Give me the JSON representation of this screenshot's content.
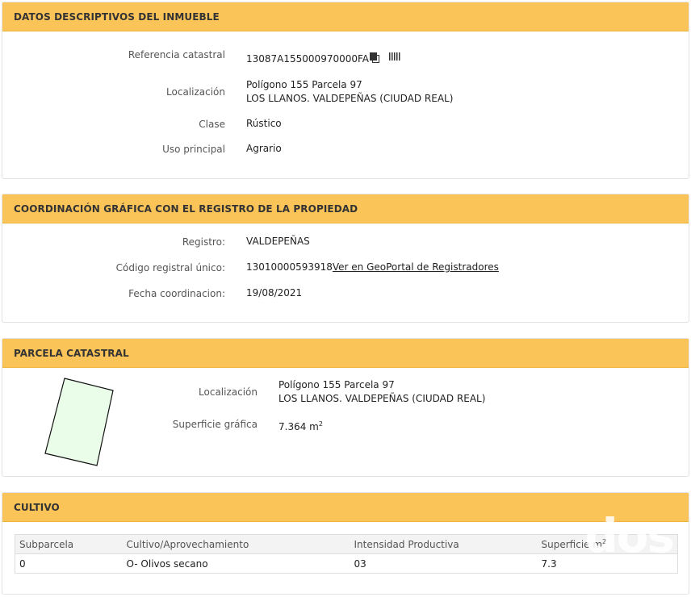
{
  "datos": {
    "title": "DATOS DESCRIPTIVOS DEL INMUEBLE",
    "ref_label": "Referencia catastral",
    "ref_value": "13087A155000970000FA",
    "loc_label": "Localización",
    "loc_line1": "Polígono 155 Parcela 97",
    "loc_line2": "LOS LLANOS. VALDEPEÑAS (CIUDAD REAL)",
    "clase_label": "Clase",
    "clase_value": "Rústico",
    "uso_label": "Uso principal",
    "uso_value": "Agrario"
  },
  "coordinacion": {
    "title": "COORDINACIÓN GRÁFICA CON EL REGISTRO DE LA PROPIEDAD",
    "registro_label": "Registro:",
    "registro_value": "VALDEPEÑAS",
    "codigo_label": "Código registral único:",
    "codigo_value": "13010000593918",
    "codigo_link": "Ver en GeoPortal de Registradores",
    "fecha_label": "Fecha coordinacion:",
    "fecha_value": "19/08/2021"
  },
  "parcela": {
    "title": "PARCELA CATASTRAL",
    "loc_label": "Localización",
    "loc_line1": "Polígono 155 Parcela 97",
    "loc_line2": "LOS LLANOS. VALDEPEÑAS (CIUDAD REAL)",
    "sup_label": "Superficie gráfica",
    "sup_value": "7.364 m",
    "sup_exp": "2"
  },
  "cultivo": {
    "title": "CULTIVO",
    "headers": [
      "Subparcela",
      "Cultivo/Aprovechamiento",
      "Intensidad Productiva",
      "Superficie m"
    ],
    "header_exp": "2",
    "rows": [
      [
        "0",
        "O- Olivos secano",
        "03",
        "7.3"
      ]
    ]
  },
  "watermark": "dos"
}
